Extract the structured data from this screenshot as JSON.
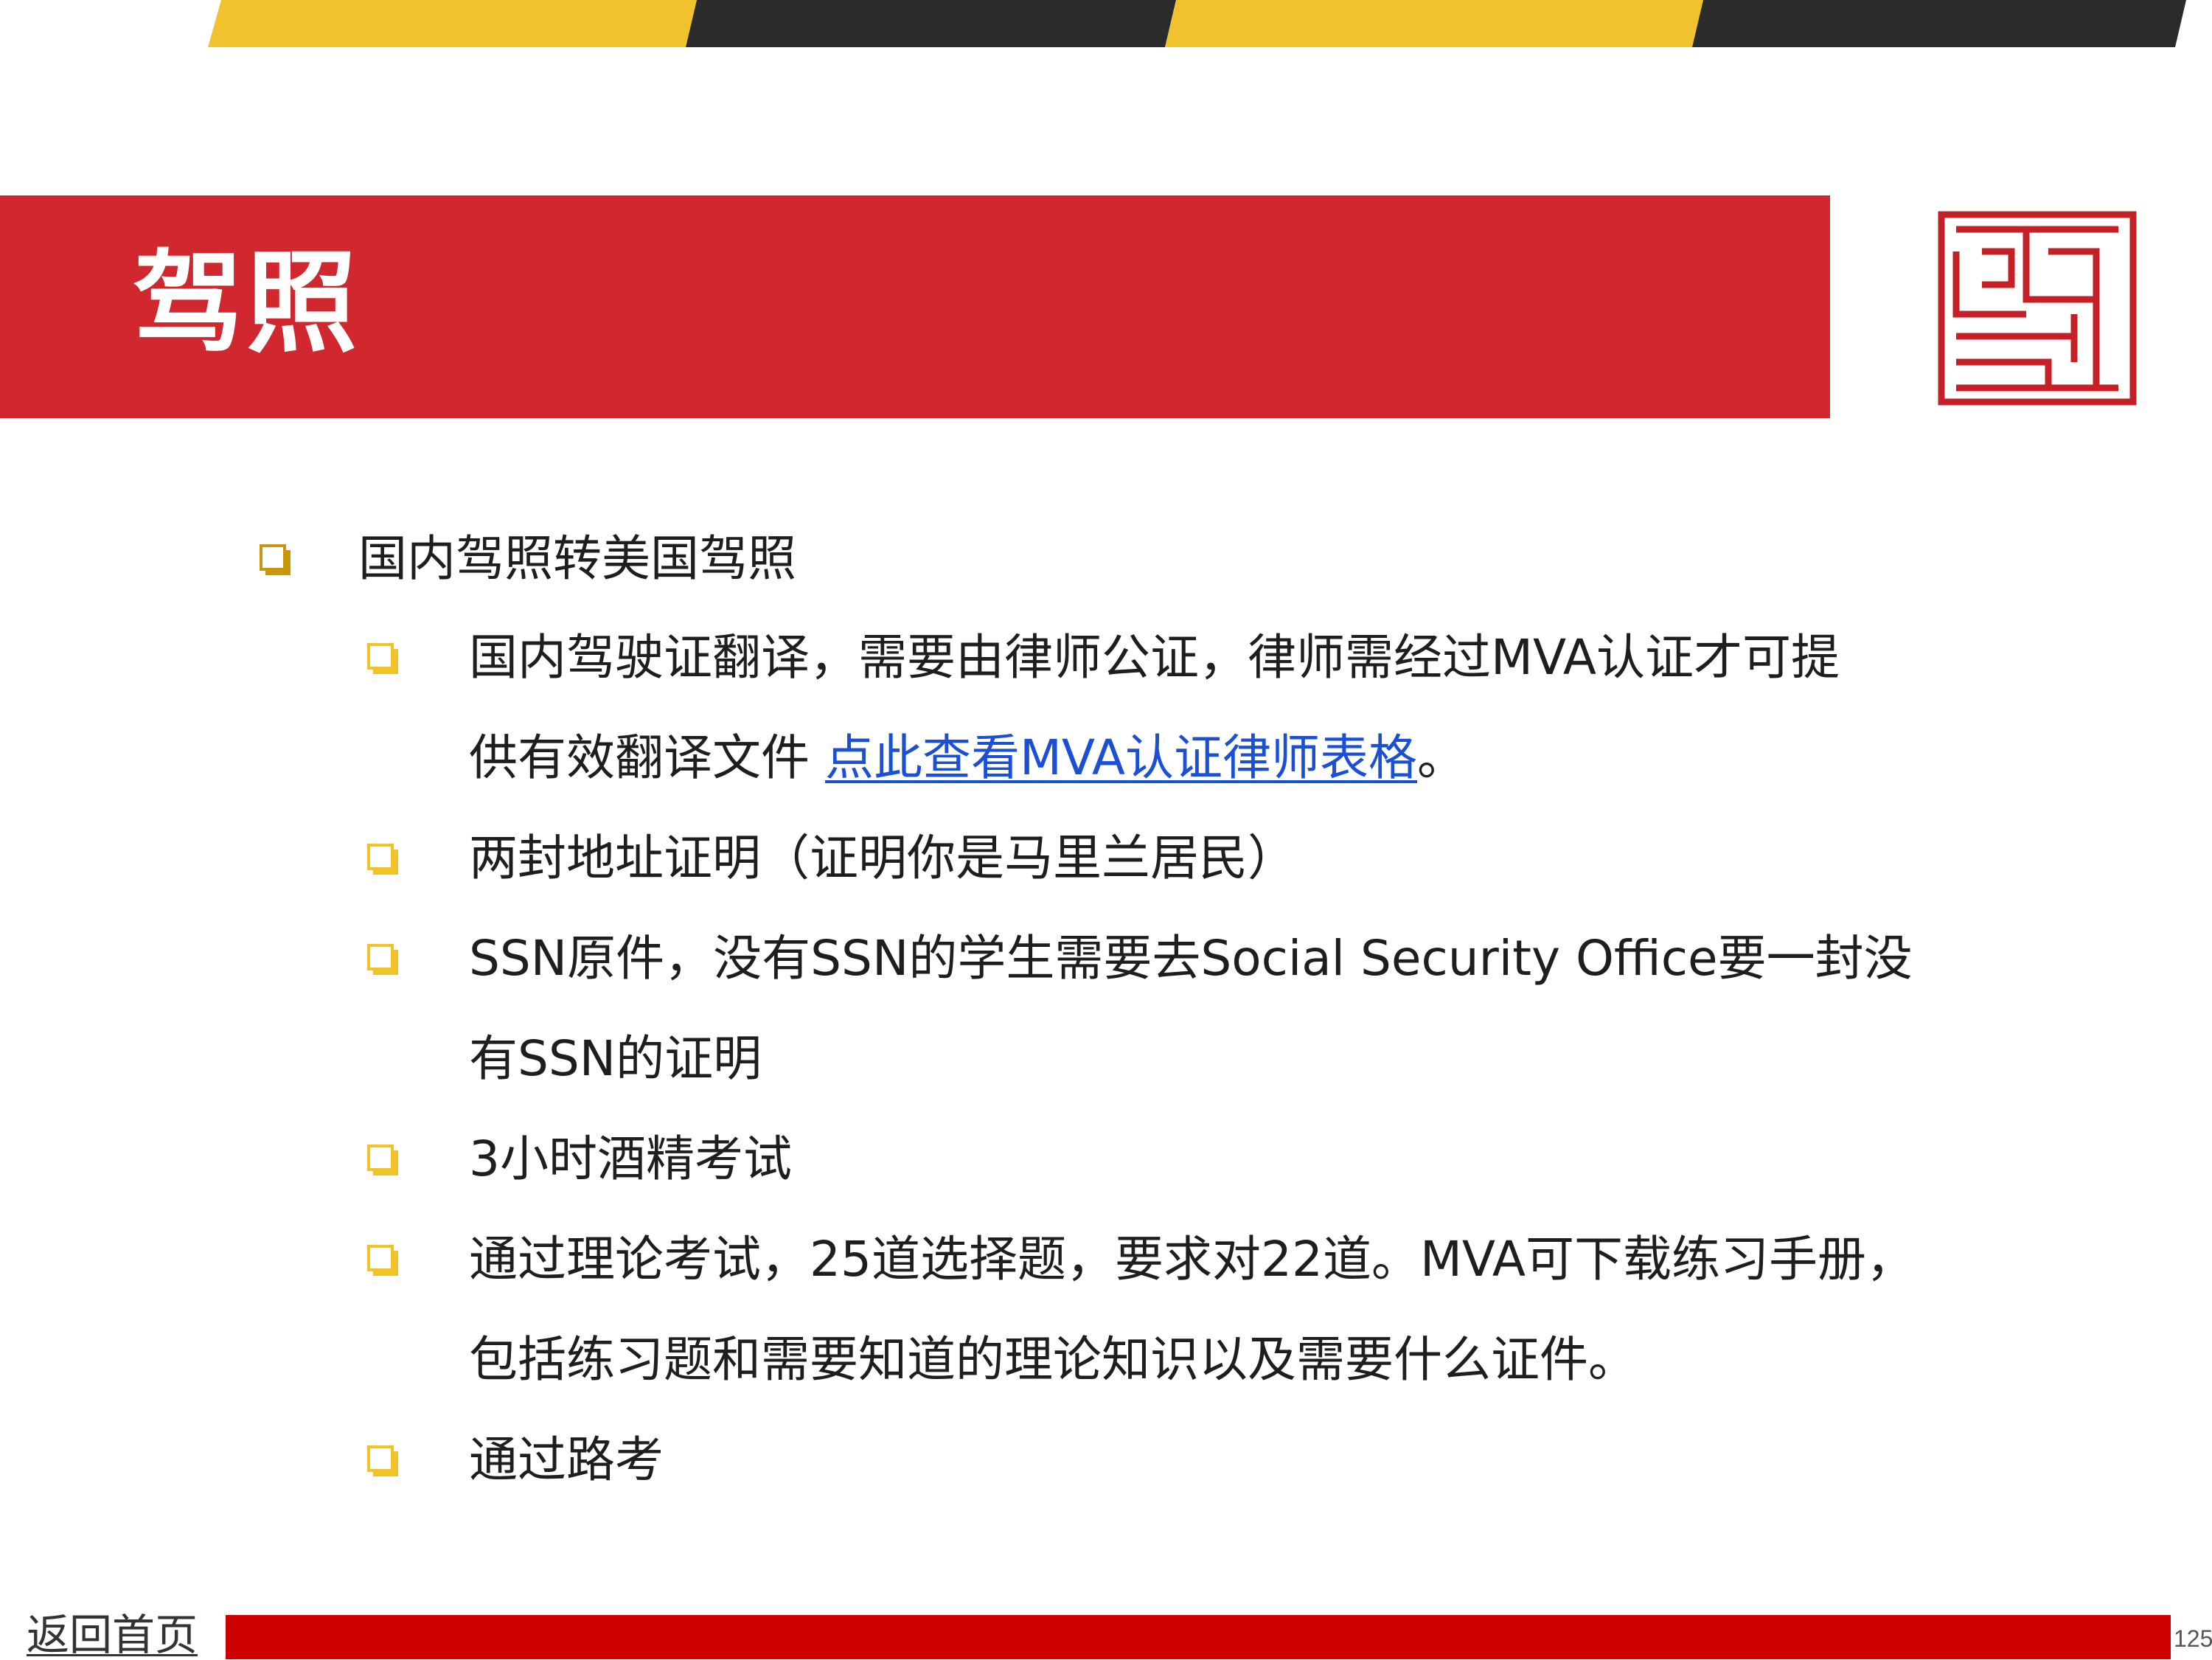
{
  "colors": {
    "yellow": "#f0c22e",
    "dark": "#2b2b2b",
    "title_red": "#d0282e",
    "footer_red": "#cc0000",
    "bullet_l1": "#c9960c",
    "bullet_l2": "#f2c229",
    "link": "#1a4fd6"
  },
  "header": {
    "title": "驾照"
  },
  "logo": {
    "icon": "seal-logo-icon"
  },
  "bullets": {
    "main": "国内驾照转美国驾照",
    "item1_line1": "国内驾驶证翻译，需要由律师公证，律师需经过MVA认证才可提",
    "item1_line2_prefix": "供有效翻译文件 ",
    "item1_link": "点此查看MVA认证律师表格",
    "item1_line2_suffix": "。",
    "item2": "两封地址证明（证明你是马里兰居民）",
    "item3_line1": "SSN原件，没有SSN的学生需要去Social Security Office要一封没",
    "item3_line2": "有SSN的证明",
    "item4": "3小时酒精考试",
    "item5_line1": "通过理论考试，25道选择题，要求对22道。MVA可下载练习手册，",
    "item5_line2": "包括练习题和需要知道的理论知识以及需要什么证件。",
    "item6": "通过路考"
  },
  "footer": {
    "home_link": "返回首页",
    "page_number": "125"
  }
}
